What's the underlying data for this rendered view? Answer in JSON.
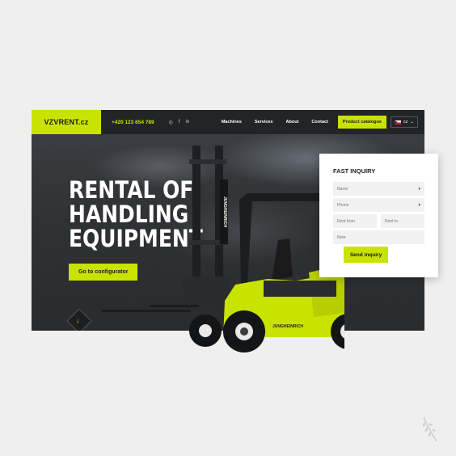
{
  "brand": {
    "logo": "VZVRENT.cz",
    "accent": "#c9e300"
  },
  "header": {
    "phone": "+420 123 654 789",
    "socials": [
      "instagram-icon",
      "facebook-icon",
      "linkedin-icon"
    ],
    "social_glyphs": [
      "◎",
      "f",
      "in"
    ],
    "menu": [
      "Machines",
      "Services",
      "About",
      "Contact"
    ],
    "cta_label": "Product catalogue",
    "language": "cz"
  },
  "hero": {
    "title_lines": [
      "RENTAL OF",
      "HANDLING",
      "EQUIPMENT"
    ],
    "button_label": "Go to configurator",
    "scroll_glyph": "↓"
  },
  "forklift": {
    "brand_text": "JUNGHEINRICH"
  },
  "inquiry": {
    "title": "FAST INQUIRY",
    "name_placeholder": "Name",
    "phone_placeholder": "Phone",
    "rent_from_placeholder": "Rent from",
    "rent_to_placeholder": "Rent to",
    "note_placeholder": "Note",
    "submit_label": "Send inquiry"
  }
}
